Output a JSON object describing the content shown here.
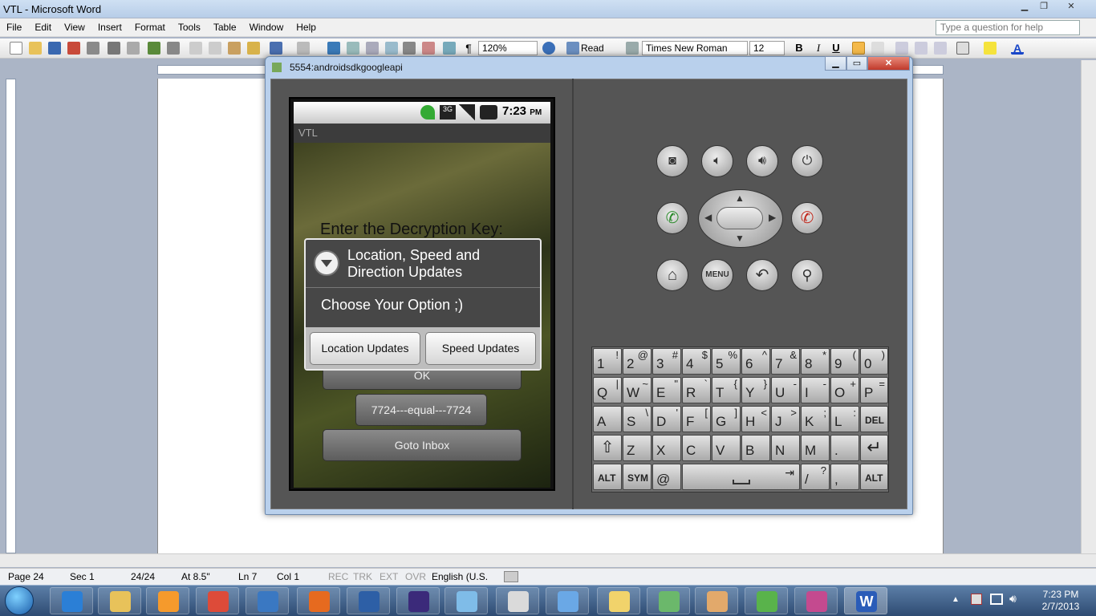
{
  "word": {
    "title": "VTL - Microsoft Word",
    "menu": [
      "File",
      "Edit",
      "View",
      "Insert",
      "Format",
      "Tools",
      "Table",
      "Window",
      "Help"
    ],
    "help_placeholder": "Type a question for help",
    "zoom": "120%",
    "read_label": "Read",
    "font_name": "Times New Roman",
    "font_size": "12",
    "bold": "B",
    "italic": "I",
    "underline": "U",
    "status": {
      "page": "Page 24",
      "sec": "Sec 1",
      "pages": "24/24",
      "at": "At 8.5\"",
      "ln": "Ln 7",
      "col": "Col 1",
      "rec": "REC",
      "trk": "TRK",
      "ext": "EXT",
      "ovr": "OVR",
      "lang": "English (U.S."
    }
  },
  "emulator": {
    "title": "5554:androidsdkgoogleapi",
    "screen": {
      "time": "7:23",
      "ampm": "PM",
      "app_title": "VTL",
      "prompt": "Enter the Decryption Key:",
      "ok_button": "OK",
      "result": "7724---equal---7724",
      "inbox_button": "Goto Inbox",
      "dialog": {
        "title": "Location, Speed and Direction Updates",
        "message": "Choose Your Option ;)",
        "button_left": "Location Updates",
        "button_right": "Speed Updates"
      }
    },
    "controls": {
      "menu_label": "MENU"
    },
    "keyboard": {
      "row1": [
        [
          "1",
          "!"
        ],
        [
          "2",
          "@"
        ],
        [
          "3",
          "#"
        ],
        [
          "4",
          "$"
        ],
        [
          "5",
          "%"
        ],
        [
          "6",
          "^"
        ],
        [
          "7",
          "&"
        ],
        [
          "8",
          "*"
        ],
        [
          "9",
          "("
        ],
        [
          "0",
          ")"
        ]
      ],
      "row2": [
        [
          "Q",
          "|"
        ],
        [
          "W",
          "~"
        ],
        [
          "E",
          "\""
        ],
        [
          "R",
          "`"
        ],
        [
          "T",
          "{"
        ],
        [
          "Y",
          "}"
        ],
        [
          "U",
          "-"
        ],
        [
          "I",
          "-"
        ],
        [
          "O",
          "+"
        ],
        [
          "P",
          "="
        ]
      ],
      "row3": [
        [
          "A",
          ""
        ],
        [
          "S",
          "\\"
        ],
        [
          "D",
          "'"
        ],
        [
          "F",
          "["
        ],
        [
          "G",
          "]"
        ],
        [
          "H",
          "<"
        ],
        [
          "J",
          ">"
        ],
        [
          "K",
          ";"
        ],
        [
          "L",
          ":"
        ]
      ],
      "del": "DEL",
      "row4": [
        [
          "Z",
          ""
        ],
        [
          "X",
          ""
        ],
        [
          "C",
          ""
        ],
        [
          "V",
          ""
        ],
        [
          "B",
          ""
        ],
        [
          "N",
          ""
        ],
        [
          "M",
          ""
        ],
        [
          ".",
          ""
        ]
      ],
      "alt": "ALT",
      "sym": "SYM",
      "at": "@",
      "slash": [
        "/",
        "?"
      ],
      "comma": ","
    }
  },
  "taskbar": {
    "time": "7:23 PM",
    "date": "2/7/2013",
    "colors": {
      "ie": "#2b7fd6",
      "explorer": "#e8c25a",
      "media": "#f59a2c",
      "chrome": "#dd4b39",
      "tool": "#3a78c2",
      "firefox": "#e66a1f",
      "eclipse8": "#2d5fa6",
      "eclipse": "#3b2a7a",
      "notepad": "#7fbce8",
      "calc": "#dadada",
      "box": "#6aa8e6",
      "folder": "#f1d36b",
      "photo": "#6bb86b",
      "paint": "#e2a96b",
      "search": "#59b34b",
      "rocket": "#c44a8f",
      "word": "#2a5cb8"
    }
  }
}
